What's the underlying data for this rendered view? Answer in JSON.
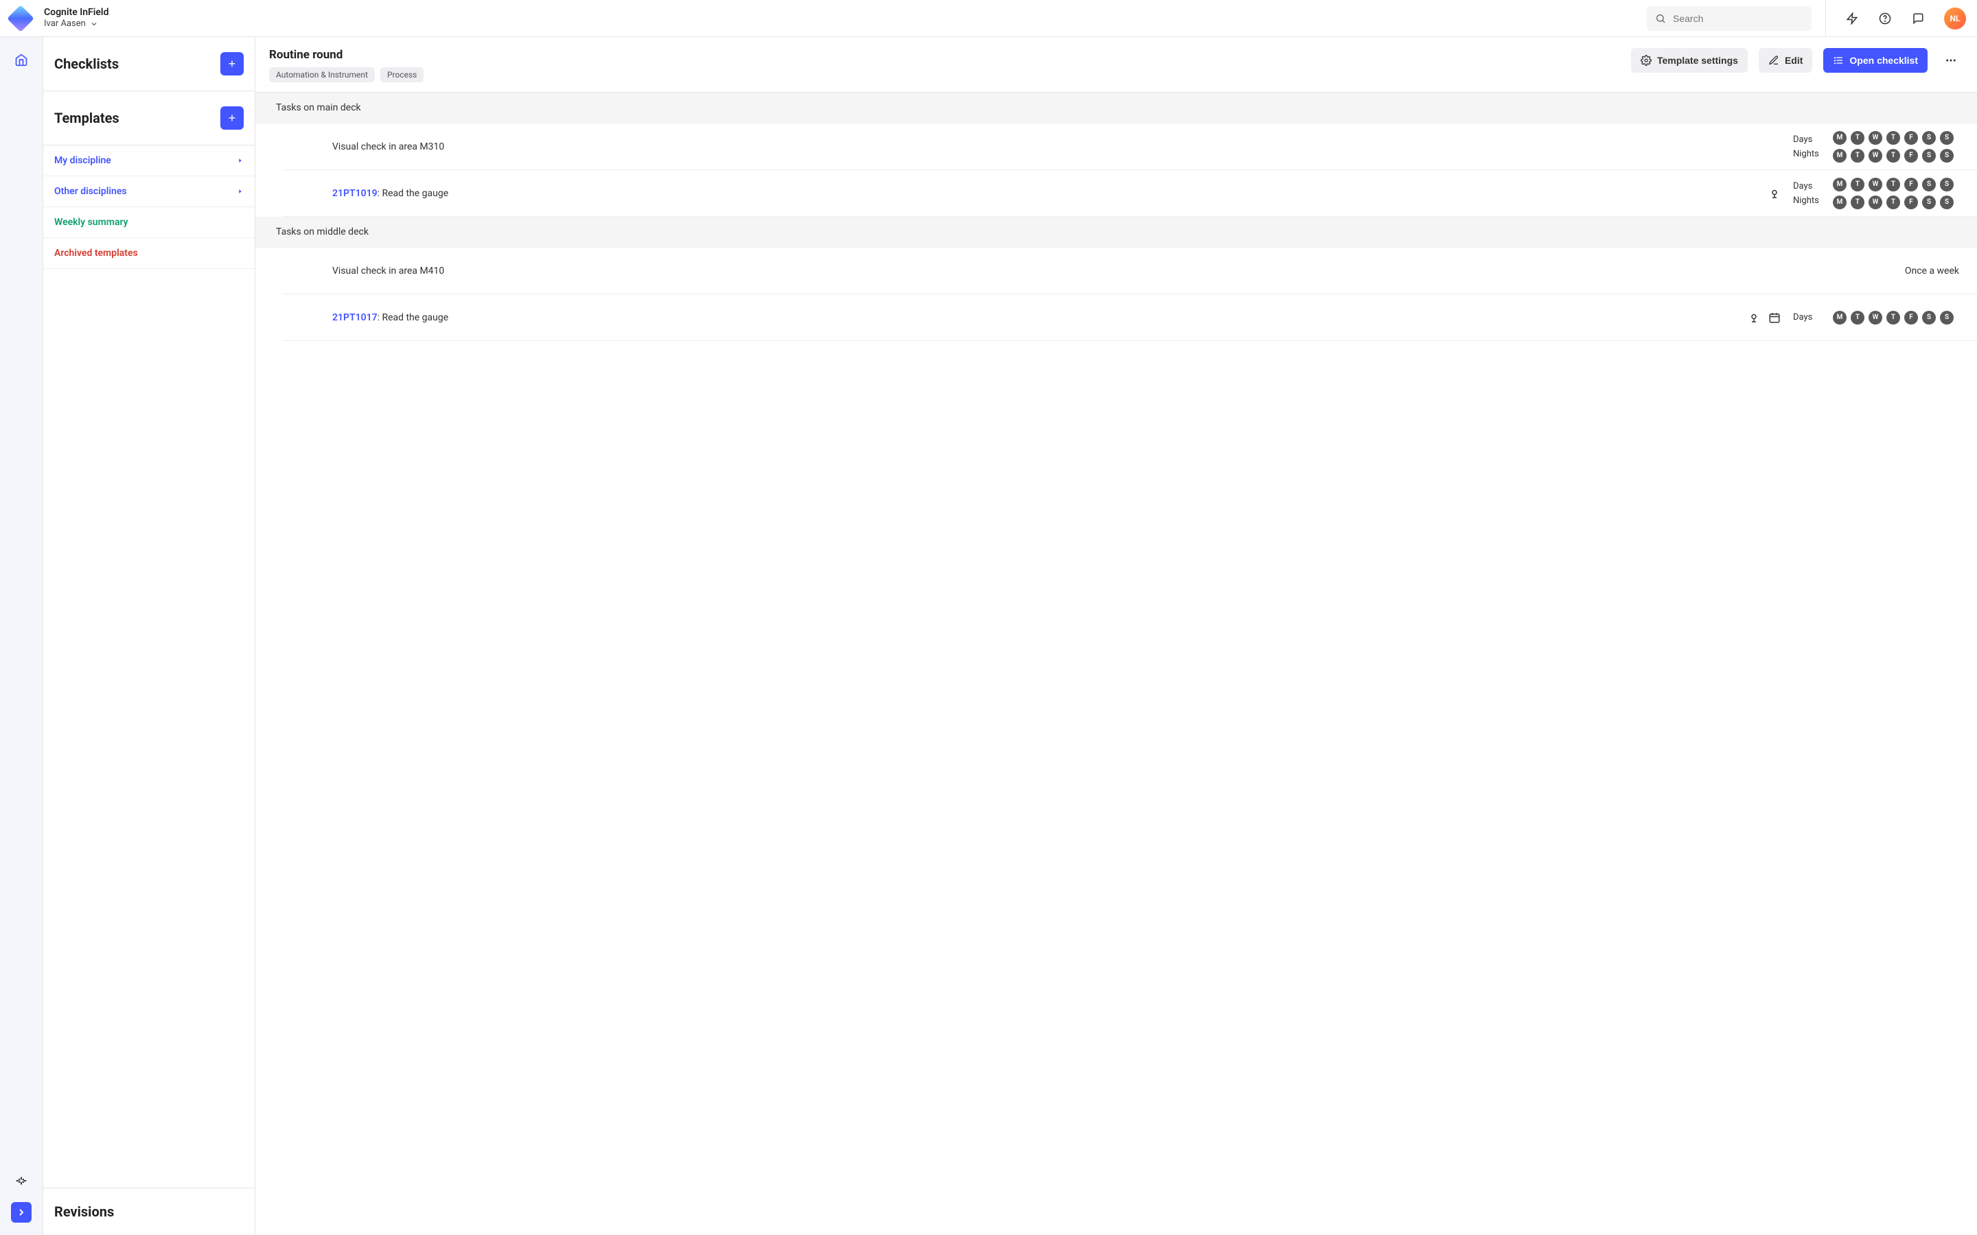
{
  "app": {
    "name": "Cognite InField",
    "project": "Ivar Aasen"
  },
  "search": {
    "placeholder": "Search"
  },
  "user": {
    "initials": "NL"
  },
  "sidebar": {
    "checklists_title": "Checklists",
    "templates_title": "Templates",
    "items": {
      "my_discipline": "My discipline",
      "other_disciplines": "Other disciplines",
      "weekly_summary": "Weekly summary",
      "archived": "Archived templates"
    },
    "revisions_title": "Revisions"
  },
  "main": {
    "title": "Routine round",
    "tags": [
      "Automation & Instrument",
      "Process"
    ],
    "buttons": {
      "template_settings": "Template settings",
      "edit": "Edit",
      "open_checklist": "Open checklist"
    }
  },
  "groups": [
    {
      "title": "Tasks on main deck",
      "tasks": [
        {
          "kind": "text",
          "label": "Visual check in area M310",
          "icons": [],
          "schedule": [
            {
              "label": "Days",
              "days": [
                "M",
                "T",
                "W",
                "T",
                "F",
                "S",
                "S"
              ]
            },
            {
              "label": "Nights",
              "days": [
                "M",
                "T",
                "W",
                "T",
                "F",
                "S",
                "S"
              ]
            }
          ]
        },
        {
          "kind": "asset",
          "asset": "21PT1019",
          "rest": ": Read the gauge",
          "icons": [
            "location"
          ],
          "schedule": [
            {
              "label": "Days",
              "days": [
                "M",
                "T",
                "W",
                "T",
                "F",
                "S",
                "S"
              ]
            },
            {
              "label": "Nights",
              "days": [
                "M",
                "T",
                "W",
                "T",
                "F",
                "S",
                "S"
              ]
            }
          ]
        }
      ]
    },
    {
      "title": "Tasks on middle deck",
      "tasks": [
        {
          "kind": "text",
          "label": "Visual check in area M410",
          "icons": [],
          "freq_text": "Once a week"
        },
        {
          "kind": "asset",
          "asset": "21PT1017",
          "rest": ": Read the gauge",
          "icons": [
            "location",
            "calendar"
          ],
          "schedule": [
            {
              "label": "Days",
              "days": [
                "M",
                "T",
                "W",
                "T",
                "F",
                "S",
                "S"
              ]
            }
          ]
        }
      ]
    }
  ]
}
